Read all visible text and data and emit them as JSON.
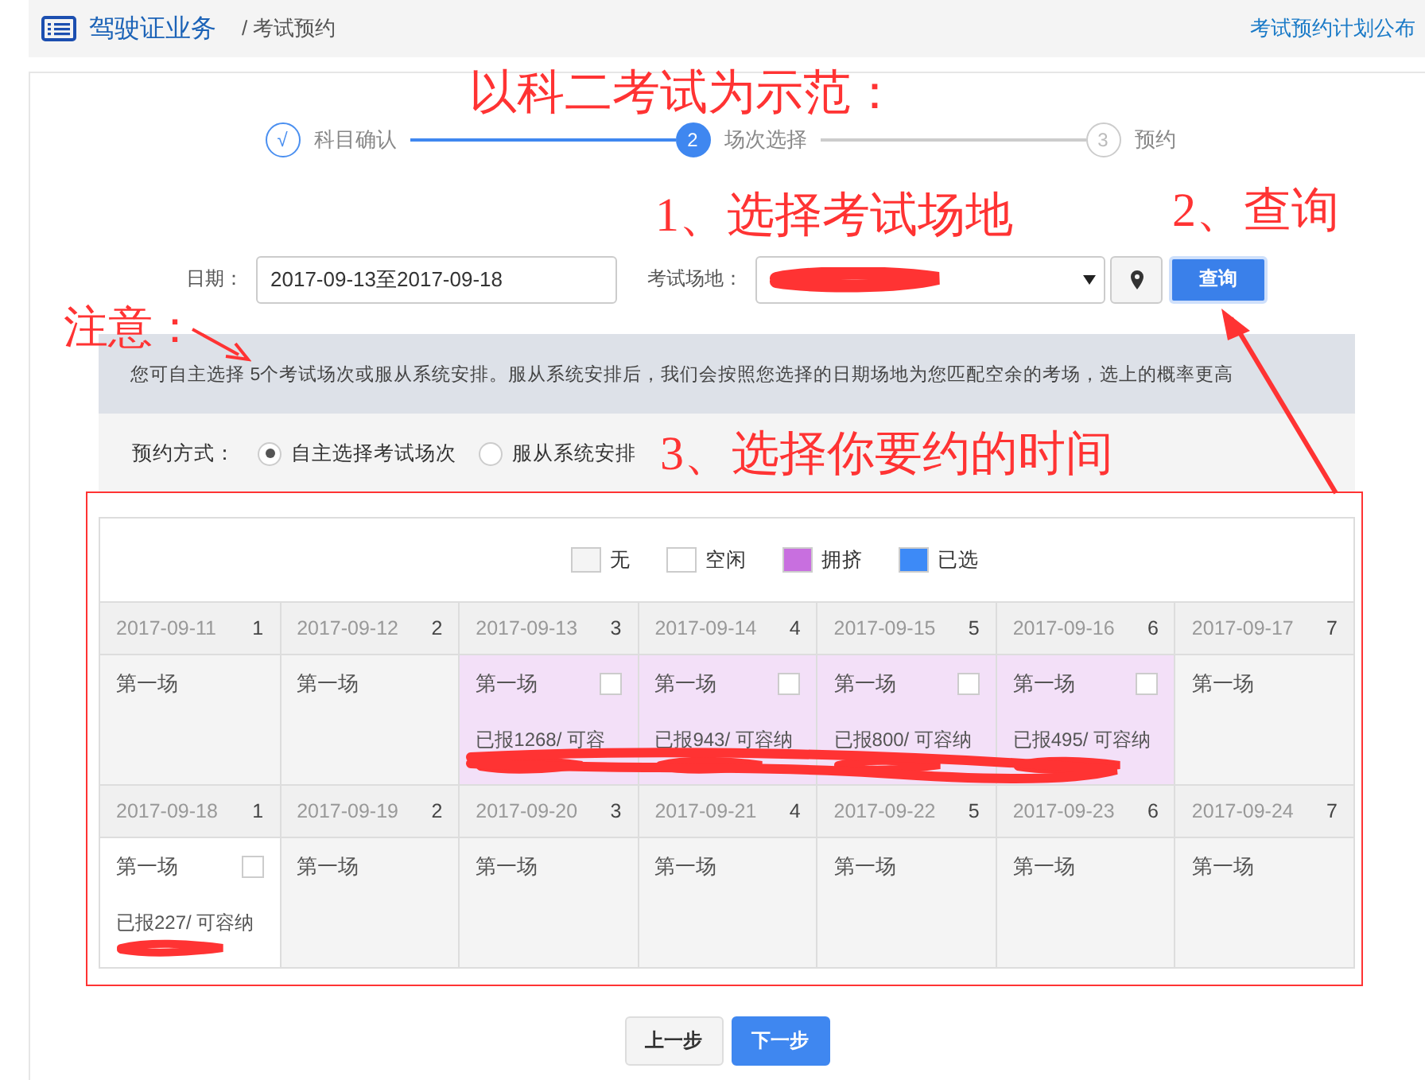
{
  "breadcrumb": {
    "title": "驾驶证业务",
    "current": "/ 考试预约",
    "link": "考试预约计划公布"
  },
  "steps": [
    {
      "number": "√",
      "label": "科目确认",
      "done": true,
      "selected": false
    },
    {
      "number": "2",
      "label": "场次选择",
      "done": false,
      "selected": true
    },
    {
      "number": "3",
      "label": "预约",
      "done": false,
      "selected": false
    }
  ],
  "form": {
    "date_label": "日期：",
    "date_value": "2017-09-13至2017-09-18",
    "venue_label": "考试场地：",
    "search_button": "查询"
  },
  "notice": "您可自主选择 5个考试场次或服从系统安排。服从系统安排后，我们会按照您选择的日期场地为您匹配空余的考场，选上的概率更高",
  "mode": {
    "label": "预约方式：",
    "options": [
      {
        "label": "自主选择考试场次",
        "selected": true
      },
      {
        "label": "服从系统安排",
        "selected": false
      }
    ]
  },
  "legend": [
    {
      "label": "无",
      "color": "#f4f4f4"
    },
    {
      "label": "空闲",
      "color": "#ffffff"
    },
    {
      "label": "拥挤",
      "color": "#c86fdf"
    },
    {
      "label": "已选",
      "color": "#3d8af7"
    }
  ],
  "weeks": [
    [
      {
        "date": "2017-09-11",
        "weekday": "1",
        "session": "第一场",
        "kind": "none"
      },
      {
        "date": "2017-09-12",
        "weekday": "2",
        "session": "第一场",
        "kind": "none"
      },
      {
        "date": "2017-09-13",
        "weekday": "3",
        "session": "第一场",
        "kind": "crowded",
        "checked": false,
        "quota": "已报1268/ 可容"
      },
      {
        "date": "2017-09-14",
        "weekday": "4",
        "session": "第一场",
        "kind": "crowded",
        "checked": false,
        "quota": "已报943/ 可容纳"
      },
      {
        "date": "2017-09-15",
        "weekday": "5",
        "session": "第一场",
        "kind": "crowded",
        "checked": false,
        "quota": "已报800/ 可容纳"
      },
      {
        "date": "2017-09-16",
        "weekday": "6",
        "session": "第一场",
        "kind": "crowded",
        "checked": false,
        "quota": "已报495/ 可容纳"
      },
      {
        "date": "2017-09-17",
        "weekday": "7",
        "session": "第一场",
        "kind": "none"
      }
    ],
    [
      {
        "date": "2017-09-18",
        "weekday": "1",
        "session": "第一场",
        "kind": "free",
        "checked": false,
        "quota": "已报227/ 可容纳"
      },
      {
        "date": "2017-09-19",
        "weekday": "2",
        "session": "第一场",
        "kind": "none"
      },
      {
        "date": "2017-09-20",
        "weekday": "3",
        "session": "第一场",
        "kind": "none"
      },
      {
        "date": "2017-09-21",
        "weekday": "4",
        "session": "第一场",
        "kind": "none"
      },
      {
        "date": "2017-09-22",
        "weekday": "5",
        "session": "第一场",
        "kind": "none"
      },
      {
        "date": "2017-09-23",
        "weekday": "6",
        "session": "第一场",
        "kind": "none"
      },
      {
        "date": "2017-09-24",
        "weekday": "7",
        "session": "第一场",
        "kind": "none"
      }
    ]
  ],
  "buttons": [
    {
      "label": "上一步",
      "kind": "default"
    },
    {
      "label": "下一步",
      "kind": "primary"
    }
  ],
  "annotations": {
    "example": "以科二考试为示范：",
    "step1": "1、选择考试场地",
    "step2": "2、查询",
    "attention": "注意：",
    "step3": "3、选择你要约的时间"
  }
}
